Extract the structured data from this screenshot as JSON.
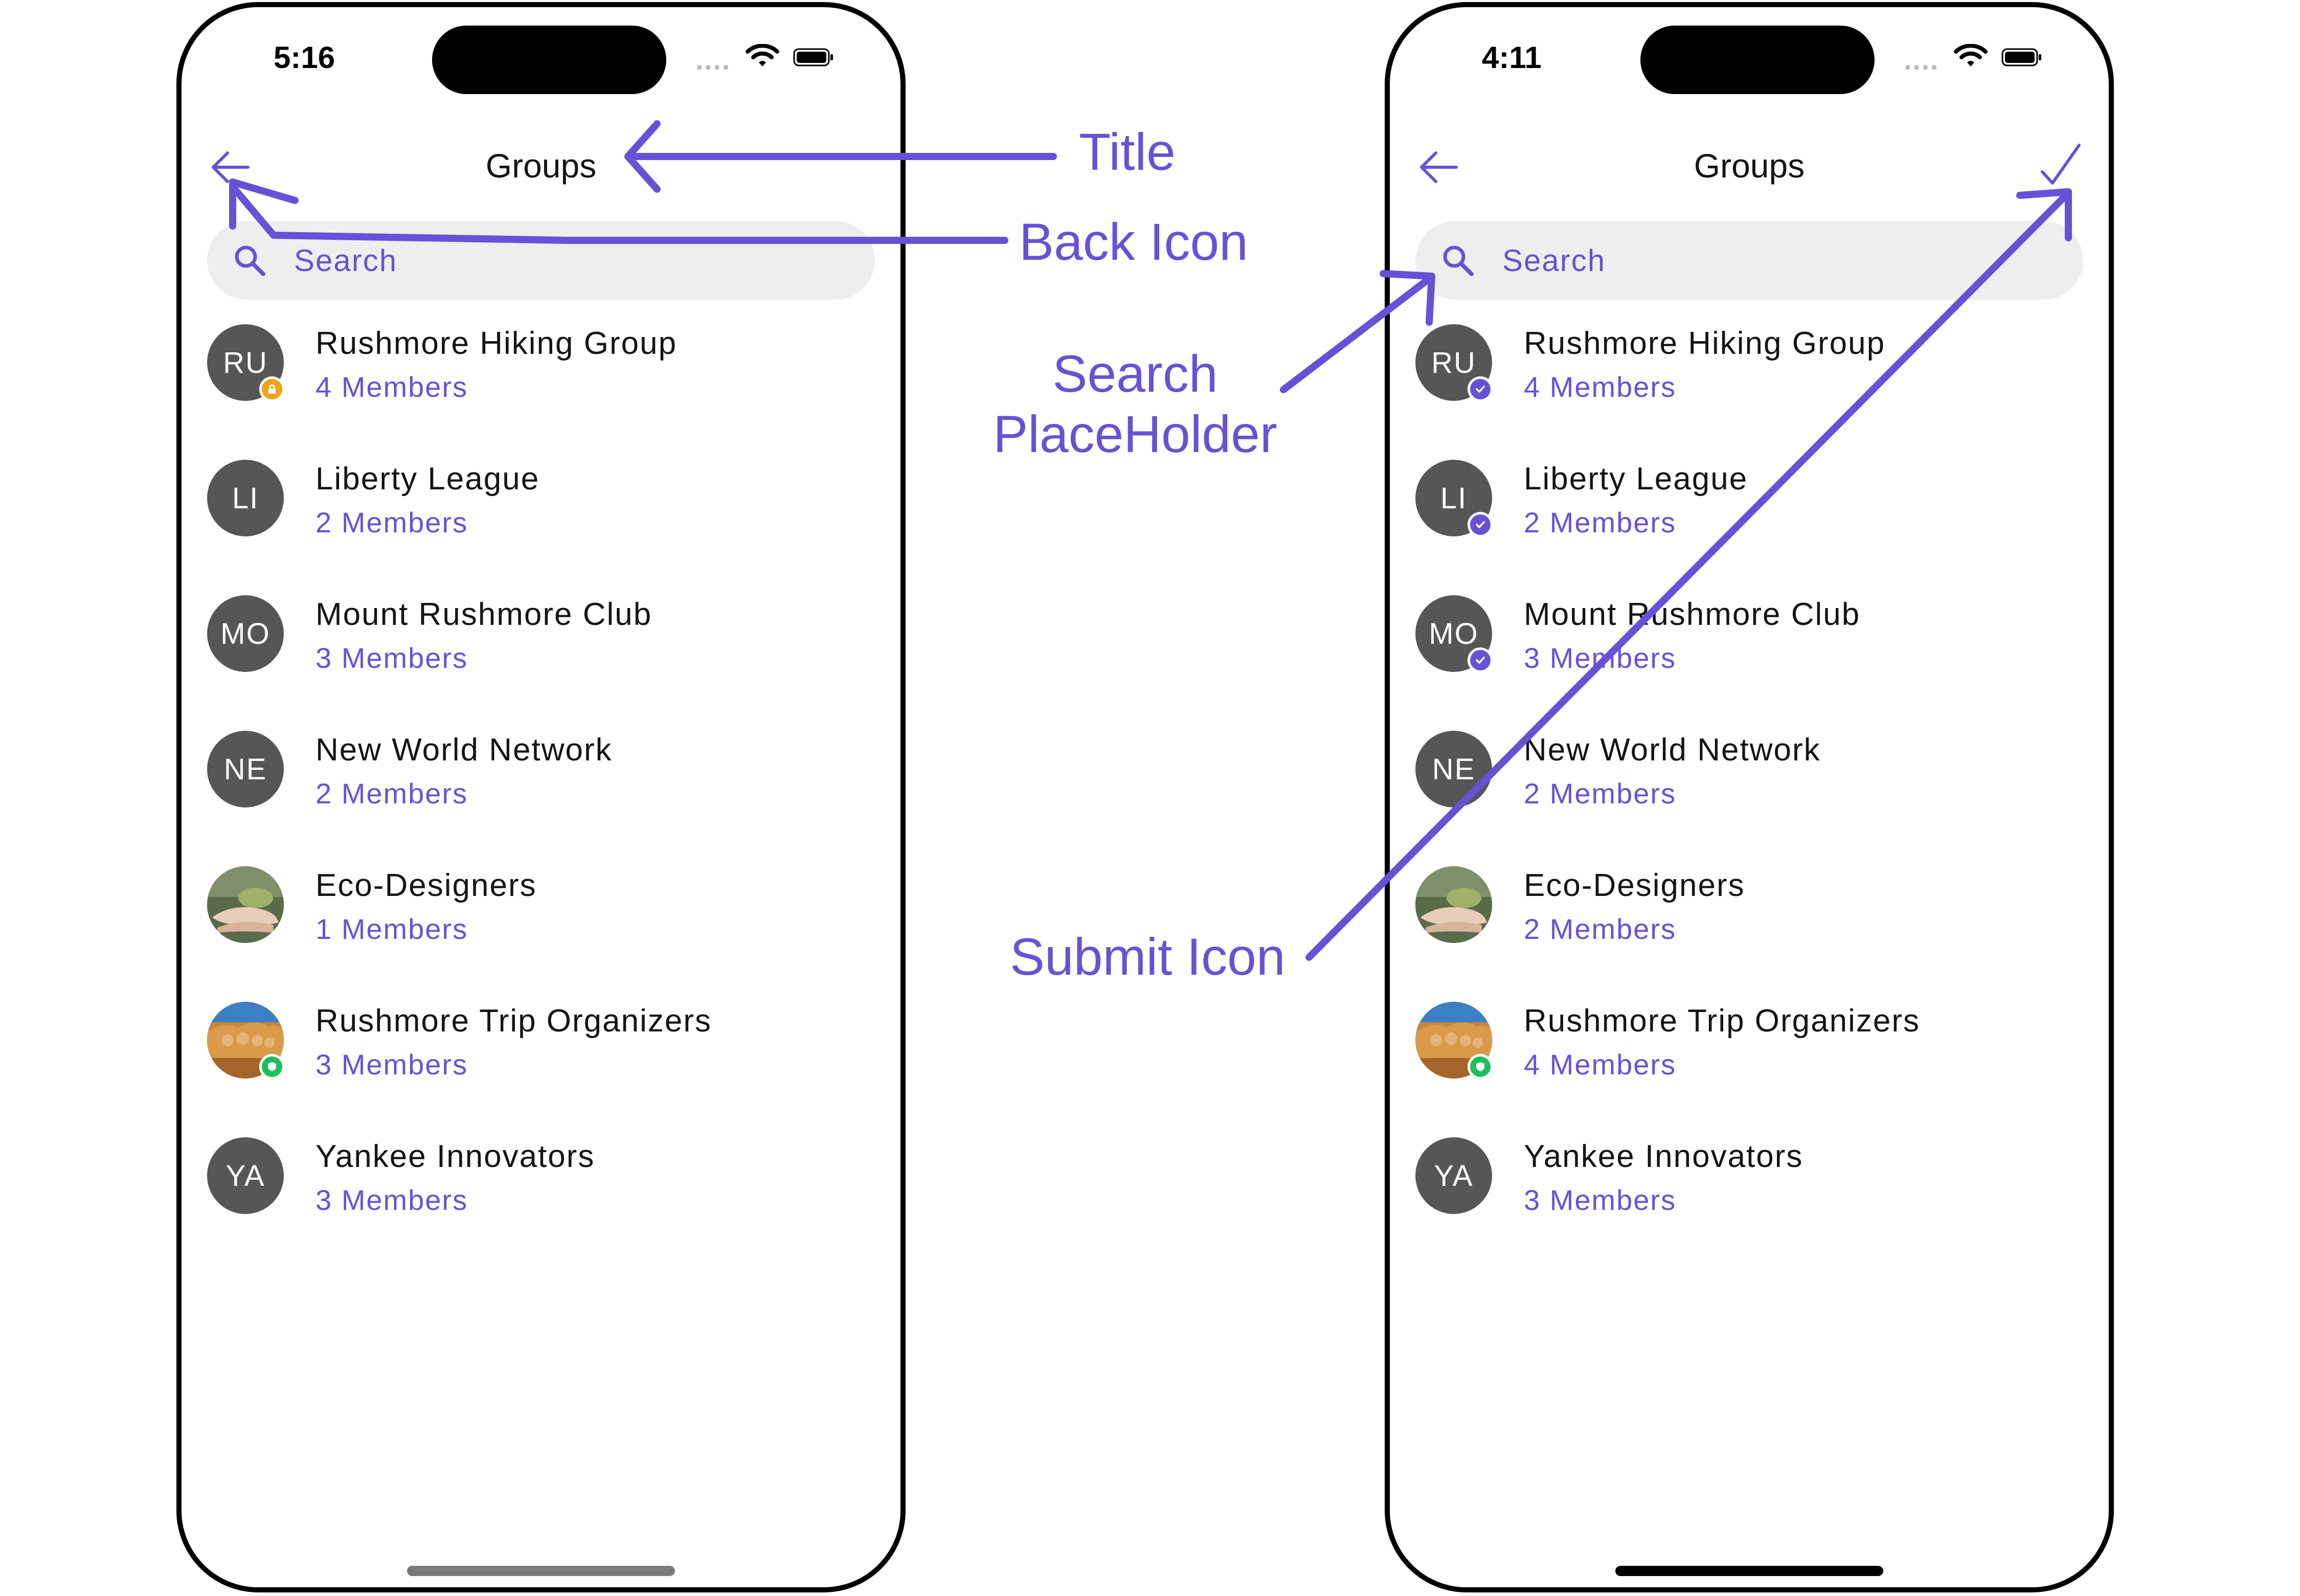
{
  "colors": {
    "accent": "#6851d6",
    "avatar_bg": "#565656",
    "search_bg": "#eeeeee",
    "badge_private": "#f0a318",
    "badge_password": "#19c05c"
  },
  "annotations": {
    "title": "Title",
    "back_icon": "Back Icon",
    "search_placeholder_line1": "Search",
    "search_placeholder_line2": "PlaceHolder",
    "submit_icon": "Submit Icon"
  },
  "left_screen": {
    "time": "5:16",
    "header": {
      "title": "Groups",
      "back_icon": "arrow-left-icon"
    },
    "search": {
      "placeholder": "Search",
      "icon": "search-icon"
    },
    "groups": [
      {
        "initials": "RU",
        "name": "Rushmore Hiking Group",
        "members": "4 Members",
        "badge": "lock-icon"
      },
      {
        "initials": "LI",
        "name": "Liberty League",
        "members": "2 Members"
      },
      {
        "initials": "MO",
        "name": "Mount Rushmore Club",
        "members": "3 Members"
      },
      {
        "initials": "NE",
        "name": "New World Network",
        "members": "2 Members"
      },
      {
        "initials": "",
        "name": "Eco-Designers",
        "members": "1 Members",
        "image": "hands-holding-plant"
      },
      {
        "initials": "",
        "name": "Rushmore Trip Organizers",
        "members": "3 Members",
        "image": "mount-rushmore",
        "badge": "shield-icon"
      },
      {
        "initials": "YA",
        "name": "Yankee Innovators",
        "members": "3 Members"
      }
    ]
  },
  "right_screen": {
    "time": "4:11",
    "header": {
      "title": "Groups",
      "back_icon": "arrow-left-icon",
      "submit_icon": "checkmark-icon"
    },
    "search": {
      "placeholder": "Search",
      "icon": "search-icon"
    },
    "groups": [
      {
        "initials": "RU",
        "name": "Rushmore Hiking Group",
        "members": "4 Members",
        "badge": "check-icon"
      },
      {
        "initials": "LI",
        "name": "Liberty League",
        "members": "2 Members",
        "badge": "check-icon"
      },
      {
        "initials": "MO",
        "name": "Mount Rushmore Club",
        "members": "3 Members",
        "badge": "check-icon"
      },
      {
        "initials": "NE",
        "name": "New World Network",
        "members": "2 Members"
      },
      {
        "initials": "",
        "name": "Eco-Designers",
        "members": "2 Members",
        "image": "hands-holding-plant"
      },
      {
        "initials": "",
        "name": "Rushmore Trip Organizers",
        "members": "4 Members",
        "image": "mount-rushmore",
        "badge": "shield-icon"
      },
      {
        "initials": "YA",
        "name": "Yankee Innovators",
        "members": "3 Members"
      }
    ]
  }
}
